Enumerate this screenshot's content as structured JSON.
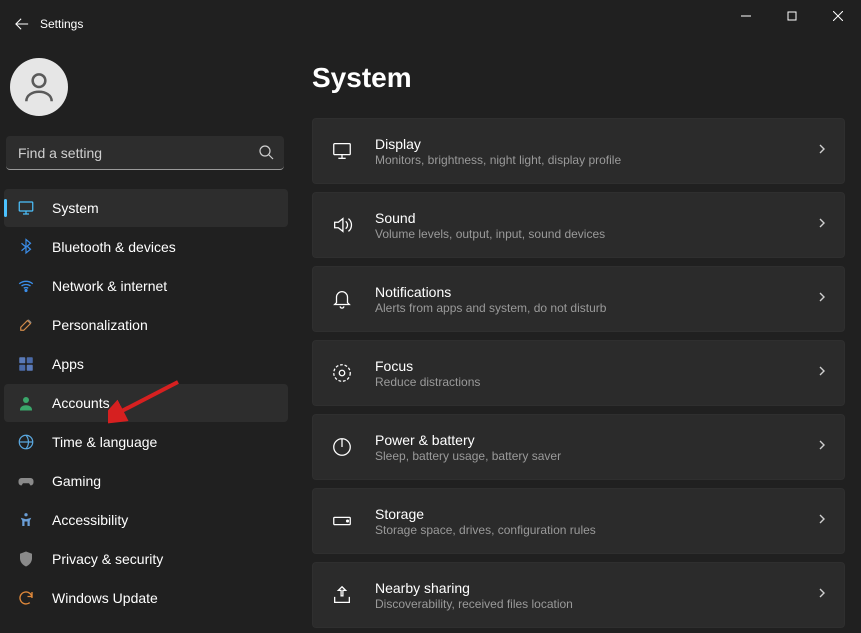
{
  "titlebar": {
    "title": "Settings"
  },
  "search": {
    "placeholder": "Find a setting"
  },
  "nav": {
    "items": [
      {
        "label": "System"
      },
      {
        "label": "Bluetooth & devices"
      },
      {
        "label": "Network & internet"
      },
      {
        "label": "Personalization"
      },
      {
        "label": "Apps"
      },
      {
        "label": "Accounts"
      },
      {
        "label": "Time & language"
      },
      {
        "label": "Gaming"
      },
      {
        "label": "Accessibility"
      },
      {
        "label": "Privacy & security"
      },
      {
        "label": "Windows Update"
      }
    ]
  },
  "page": {
    "title": "System"
  },
  "cards": [
    {
      "title": "Display",
      "sub": "Monitors, brightness, night light, display profile"
    },
    {
      "title": "Sound",
      "sub": "Volume levels, output, input, sound devices"
    },
    {
      "title": "Notifications",
      "sub": "Alerts from apps and system, do not disturb"
    },
    {
      "title": "Focus",
      "sub": "Reduce distractions"
    },
    {
      "title": "Power & battery",
      "sub": "Sleep, battery usage, battery saver"
    },
    {
      "title": "Storage",
      "sub": "Storage space, drives, configuration rules"
    },
    {
      "title": "Nearby sharing",
      "sub": "Discoverability, received files location"
    }
  ]
}
